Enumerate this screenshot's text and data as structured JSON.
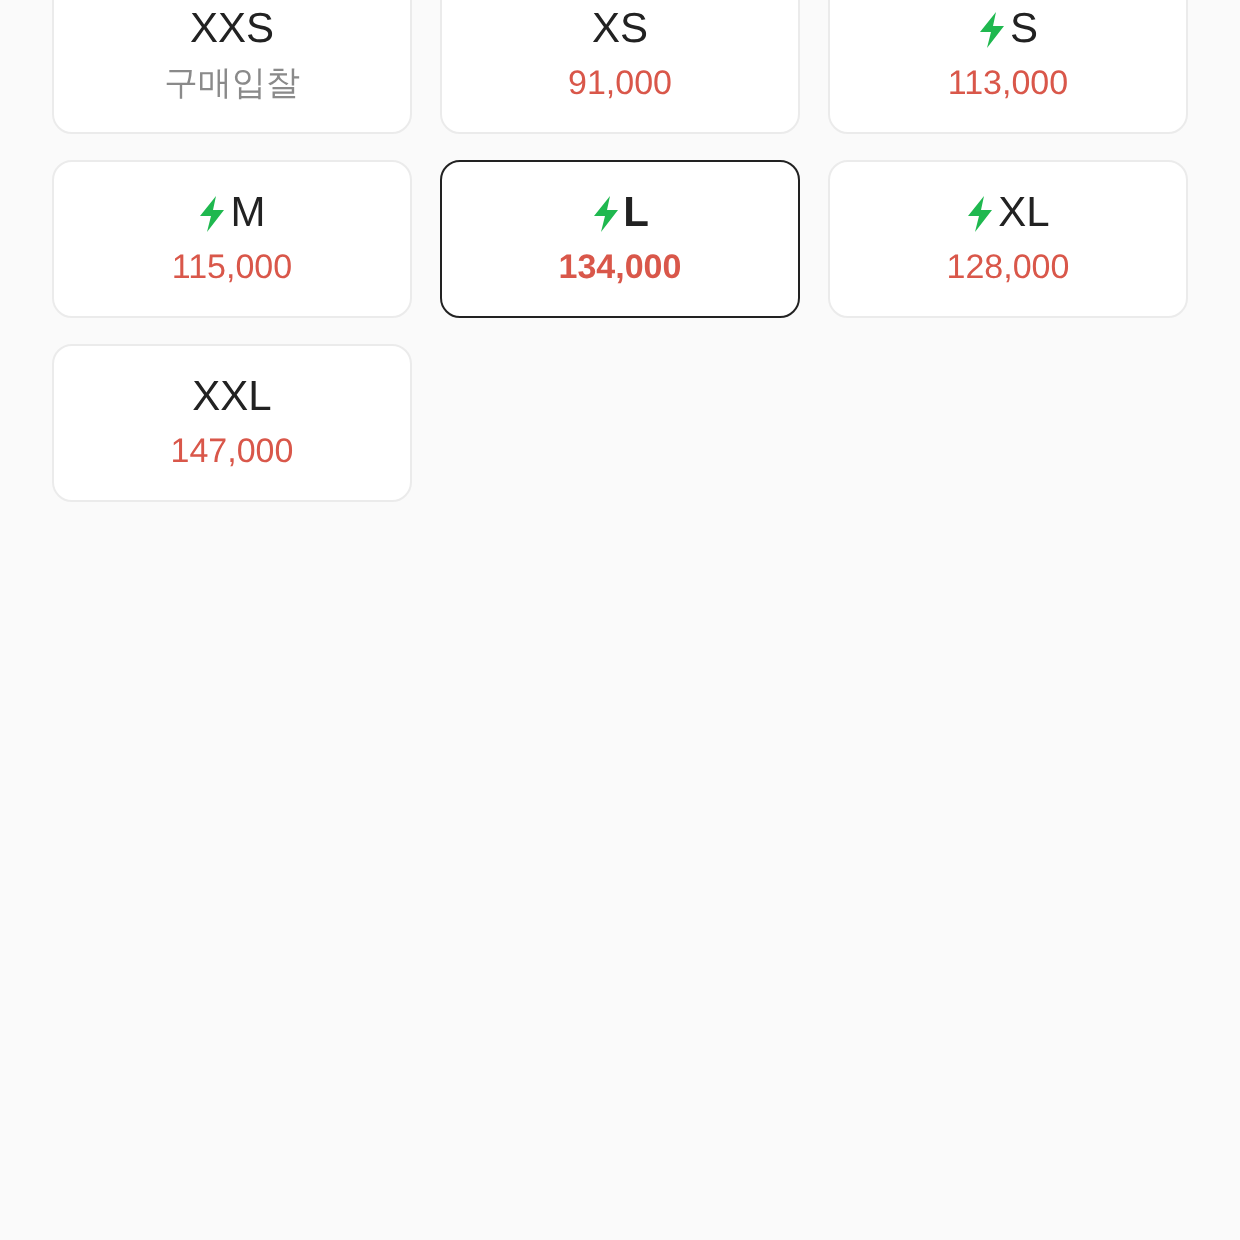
{
  "sizes": [
    {
      "size": "XXS",
      "fast": false,
      "price": "구매입찰",
      "kind": "bid",
      "selected": false
    },
    {
      "size": "XS",
      "fast": false,
      "price": "91,000",
      "kind": "price",
      "selected": false
    },
    {
      "size": "S",
      "fast": true,
      "price": "113,000",
      "kind": "price",
      "selected": false
    },
    {
      "size": "M",
      "fast": true,
      "price": "115,000",
      "kind": "price",
      "selected": false
    },
    {
      "size": "L",
      "fast": true,
      "price": "134,000",
      "kind": "price",
      "selected": true
    },
    {
      "size": "XL",
      "fast": true,
      "price": "128,000",
      "kind": "price",
      "selected": false
    },
    {
      "size": "XXL",
      "fast": false,
      "price": "147,000",
      "kind": "price",
      "selected": false
    }
  ]
}
